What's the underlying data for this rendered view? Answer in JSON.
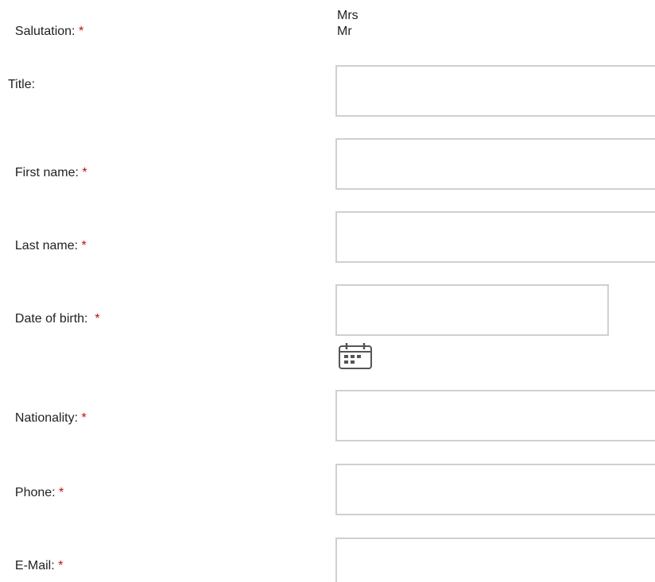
{
  "required_marker": "*",
  "colors": {
    "required": "#e00000",
    "text": "#222222",
    "field_border": "#d0d0d0",
    "icon": "#555555"
  },
  "salutation": {
    "label": "Salutation: ",
    "options": [
      "Mrs",
      "Mr"
    ]
  },
  "title": {
    "label": "Title:",
    "value": ""
  },
  "first_name": {
    "label": "First name: ",
    "value": ""
  },
  "last_name": {
    "label": "Last name: ",
    "value": ""
  },
  "date_of_birth": {
    "label": "Date of birth:  ",
    "value": "",
    "icon": "calendar-icon"
  },
  "nationality": {
    "label": "Nationality: ",
    "value": ""
  },
  "phone": {
    "label": "Phone: ",
    "value": ""
  },
  "email": {
    "label": "E-Mail: ",
    "value": ""
  }
}
